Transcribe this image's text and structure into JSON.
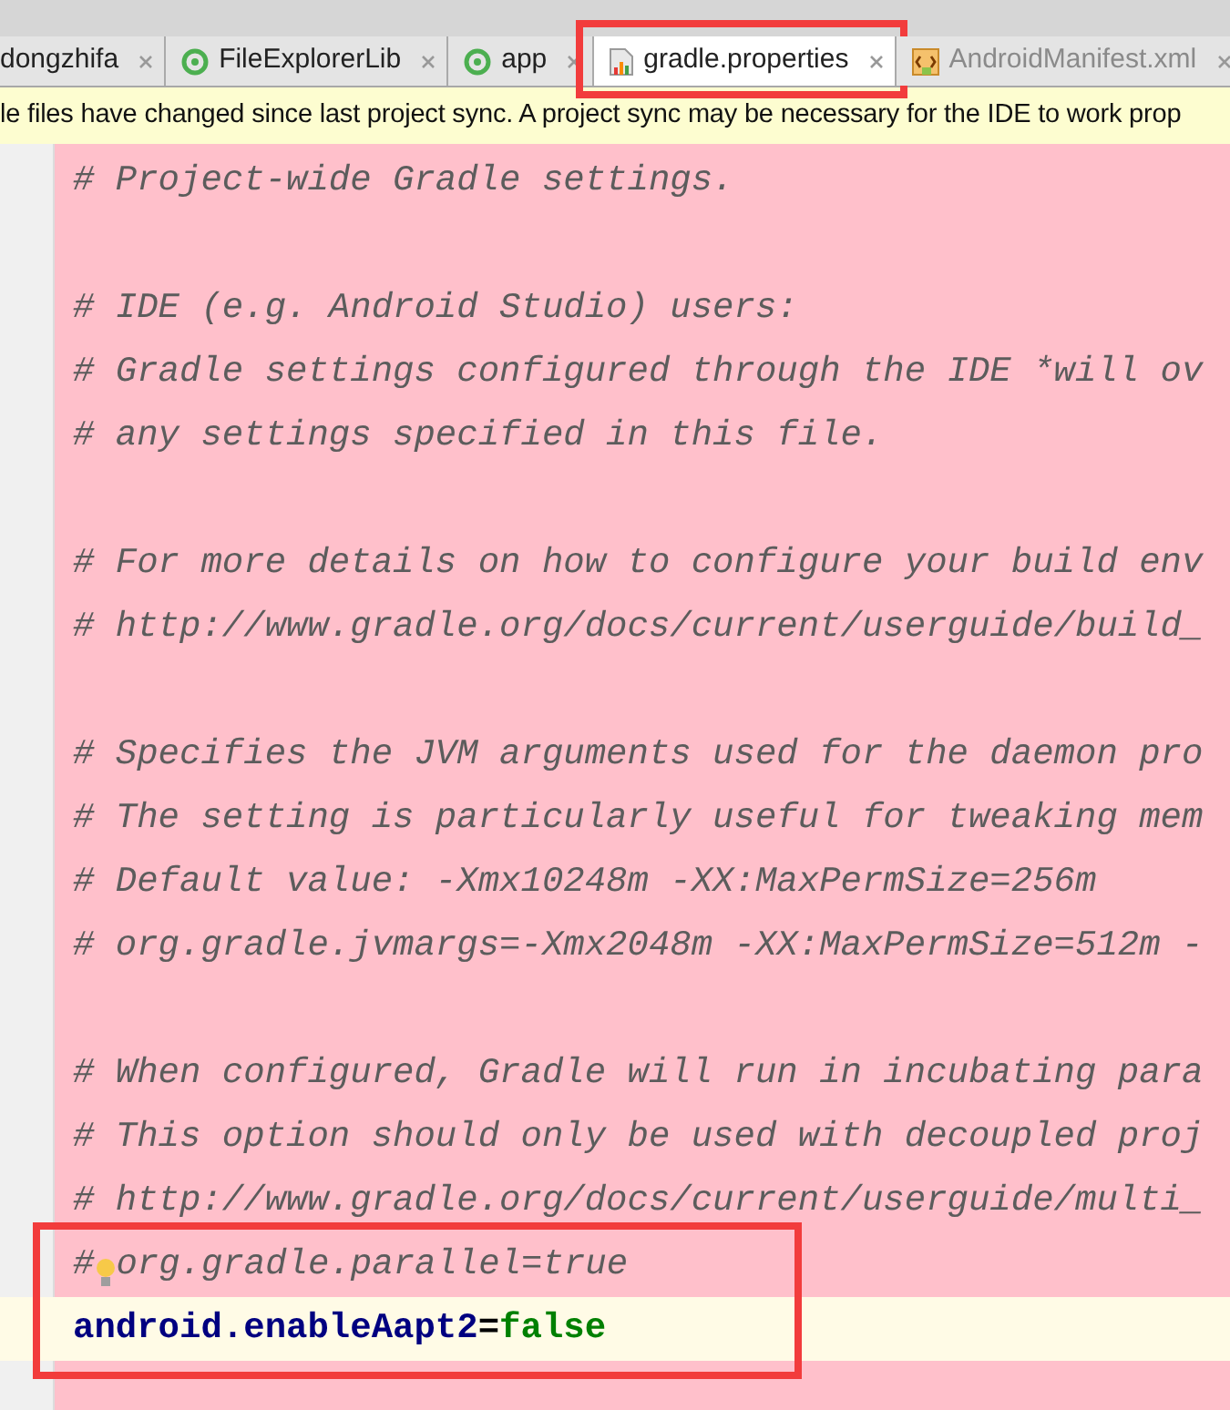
{
  "tabs": [
    {
      "label": "dongzhifa",
      "kind": "plain",
      "selected": false,
      "dimmed": false,
      "highlighted": false
    },
    {
      "label": "FileExplorerLib",
      "kind": "module",
      "selected": false,
      "dimmed": false,
      "highlighted": false
    },
    {
      "label": "app",
      "kind": "module",
      "selected": false,
      "dimmed": false,
      "highlighted": false
    },
    {
      "label": "gradle.properties",
      "kind": "properties",
      "selected": true,
      "dimmed": false,
      "highlighted": true
    },
    {
      "label": "AndroidManifest.xml",
      "kind": "manifest",
      "selected": false,
      "dimmed": true,
      "highlighted": false
    }
  ],
  "notification": {
    "text": "le files have changed since last project sync. A project sync may be necessary for the IDE to work prop"
  },
  "editor": {
    "lines": [
      {
        "kind": "comment",
        "text": "# Project-wide Gradle settings.",
        "current": false,
        "highlighted": false
      },
      {
        "kind": "blank",
        "current": false,
        "highlighted": false
      },
      {
        "kind": "comment",
        "text": "# IDE (e.g. Android Studio) users:",
        "current": false,
        "highlighted": false
      },
      {
        "kind": "comment",
        "text": "# Gradle settings configured through the IDE *will ov",
        "current": false,
        "highlighted": false
      },
      {
        "kind": "comment",
        "text": "# any settings specified in this file.",
        "current": false,
        "highlighted": false
      },
      {
        "kind": "blank",
        "current": false,
        "highlighted": false
      },
      {
        "kind": "comment",
        "text": "# For more details on how to configure your build env",
        "current": false,
        "highlighted": false
      },
      {
        "kind": "comment",
        "text": "# http://www.gradle.org/docs/current/userguide/build_",
        "current": false,
        "highlighted": false
      },
      {
        "kind": "blank",
        "current": false,
        "highlighted": false
      },
      {
        "kind": "comment",
        "text": "# Specifies the JVM arguments used for the daemon pro",
        "current": false,
        "highlighted": false
      },
      {
        "kind": "comment",
        "text": "# The setting is particularly useful for tweaking mem",
        "current": false,
        "highlighted": false
      },
      {
        "kind": "comment",
        "text": "# Default value: -Xmx10248m -XX:MaxPermSize=256m",
        "current": false,
        "highlighted": false
      },
      {
        "kind": "comment",
        "text": "# org.gradle.jvmargs=-Xmx2048m -XX:MaxPermSize=512m -",
        "current": false,
        "highlighted": false
      },
      {
        "kind": "blank",
        "current": false,
        "highlighted": false
      },
      {
        "kind": "comment",
        "text": "# When configured, Gradle will run in incubating para",
        "current": false,
        "highlighted": false
      },
      {
        "kind": "comment",
        "text": "# This option should only be used with decoupled proj",
        "current": false,
        "highlighted": false
      },
      {
        "kind": "comment",
        "text": "# http://www.gradle.org/docs/current/userguide/multi_",
        "current": false,
        "highlighted": false
      },
      {
        "kind": "intention",
        "mark": "#",
        "text": "org.gradle.parallel=true",
        "current": false,
        "highlighted": true
      },
      {
        "kind": "property",
        "key": "android.enableAapt2",
        "sep": "=",
        "value": "false",
        "current": true,
        "highlighted": true
      }
    ]
  }
}
